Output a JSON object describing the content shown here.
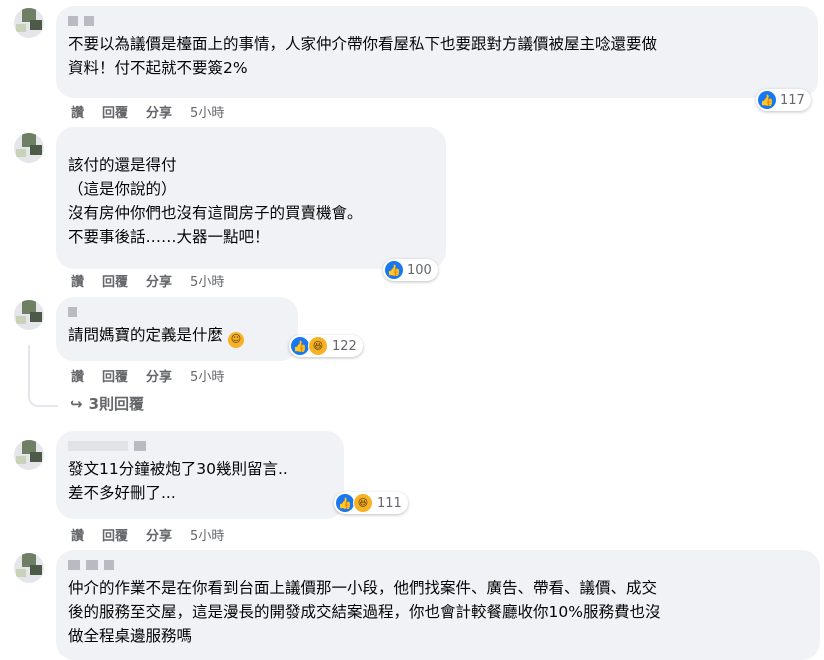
{
  "actions": {
    "like": "讚",
    "reply": "回覆",
    "share": "分享"
  },
  "comments": [
    {
      "text": "不要以為議價是檯面上的事情，人家仲介帶你看屋私下也要跟對方議價被屋主唸還要做\n資料！付不起就不要簽2%",
      "time": "5小時",
      "reaction_count": "117"
    },
    {
      "text": "該付的還是得付\n（這是你說的）\n沒有房仲你們也沒有這間房子的買賣機會。\n不要事後話……大器一點吧！",
      "time": "5小時",
      "reaction_count": "100"
    },
    {
      "text": "請問媽寶的定義是什麼",
      "time": "5小時",
      "reaction_count": "122",
      "replies_label": "3則回覆"
    },
    {
      "text": "發文11分鐘被炮了30幾則留言..\n差不多好刪了...",
      "time": "5小時",
      "reaction_count": "111"
    },
    {
      "text": "仲介的作業不是在你看到台面上議價那一小段，他們找案件、廣告、帶看、議價、成交\n後的服務至交屋，這是漫長的開發成交結案過程，你也會計較餐廳收你10%服務費也沒\n做全程桌邊服務嗎"
    }
  ],
  "icons": {
    "like": "thumbs-up-icon",
    "haha": "haha-icon",
    "reply_arrow": "reply-arrow-icon"
  }
}
